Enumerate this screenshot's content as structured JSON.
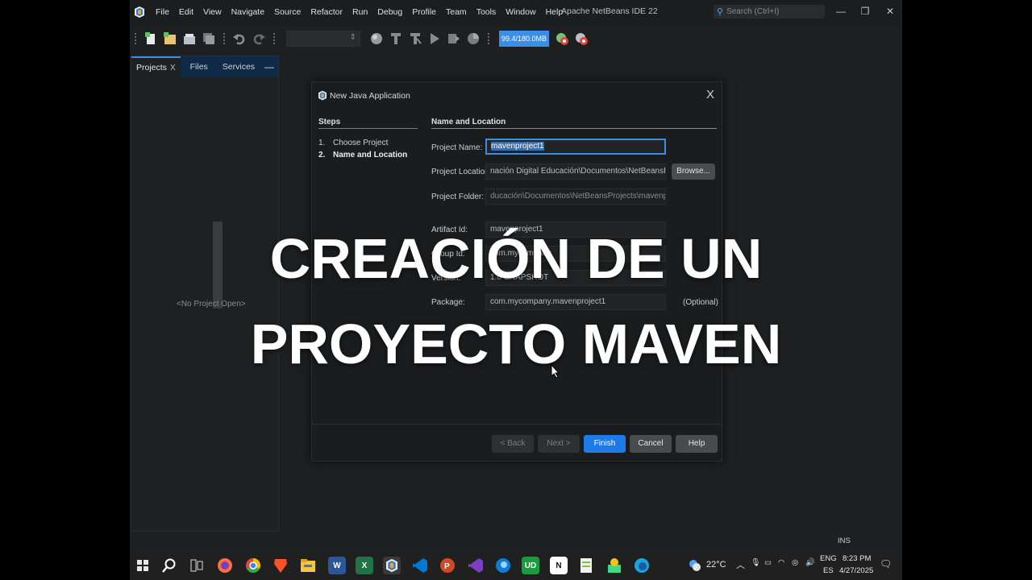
{
  "window": {
    "title": "Apache NetBeans IDE 22",
    "search_placeholder": "Search (Ctrl+I)",
    "controls": [
      "—",
      "❐",
      "✕"
    ]
  },
  "menu": [
    "File",
    "Edit",
    "View",
    "Navigate",
    "Source",
    "Refactor",
    "Run",
    "Debug",
    "Profile",
    "Team",
    "Tools",
    "Window",
    "Help"
  ],
  "toolbar": {
    "memory": "99.4/180.0MB"
  },
  "side_panel": {
    "tabs": [
      "Projects",
      "Files",
      "Services"
    ],
    "tab_close": "X",
    "minimize": "—",
    "empty_text": "<No Project Open>"
  },
  "dialog": {
    "title": "New Java Application",
    "close": "X",
    "steps_title": "Steps",
    "steps": [
      {
        "num": "1.",
        "label": "Choose Project"
      },
      {
        "num": "2.",
        "label": "Name and Location"
      }
    ],
    "section_title": "Name and Location",
    "fields": {
      "project_name": {
        "label": "Project Name:",
        "value": "mavenproject1"
      },
      "project_location": {
        "label": "Project Location:",
        "value": "nación Digital Educación\\Documentos\\NetBeansProjects"
      },
      "project_folder": {
        "label": "Project Folder:",
        "value": "ducación\\Documentos\\NetBeansProjects\\mavenproject1"
      },
      "artifact_id": {
        "label": "Artifact Id:",
        "value": "mavenproject1"
      },
      "group_id": {
        "label": "Group Id:",
        "value": "com.mycompany"
      },
      "version": {
        "label": "Version:",
        "value": "1.0-SNAPSHOT"
      },
      "package": {
        "label": "Package:",
        "value": "com.mycompany.mavenproject1"
      }
    },
    "browse_label": "Browse...",
    "optional_label": "(Optional)",
    "buttons": {
      "back": "< Back",
      "next": "Next >",
      "finish": "Finish",
      "cancel": "Cancel",
      "help": "Help"
    }
  },
  "overlay": {
    "line1": "CREACIÓN DE UN",
    "line2": "PROYECTO MAVEN"
  },
  "status": {
    "ins": "INS"
  },
  "taskbar": {
    "weather": "22°C",
    "lang1": "ENG",
    "lang2": "ES",
    "time": "8:23 PM",
    "date": "4/27/2025",
    "apps": [
      "start",
      "search",
      "task-view",
      "firefox",
      "chrome",
      "brave",
      "file-explorer",
      "word",
      "excel",
      "netbeans",
      "vscode",
      "powerpoint",
      "visual-studio",
      "edge-dev",
      "udemy",
      "notion",
      "notepad",
      "android-studio",
      "edge"
    ],
    "colors": {
      "firefox": "#ff7139",
      "chrome": "#34a853",
      "brave": "#fb542b",
      "explorer": "#f5c542",
      "word": "#2b579a",
      "excel": "#217346",
      "netbeans": "#cfd8e3",
      "vscode": "#0078d4",
      "powerpoint": "#d24726",
      "vs": "#7b3fc4",
      "edge_dev": "#0b7fd6",
      "udemy": "#1a9c3e",
      "notion": "#ffffff",
      "notepad": "#7cc242",
      "android": "#3ddc84",
      "edge": "#19a5e0"
    }
  }
}
